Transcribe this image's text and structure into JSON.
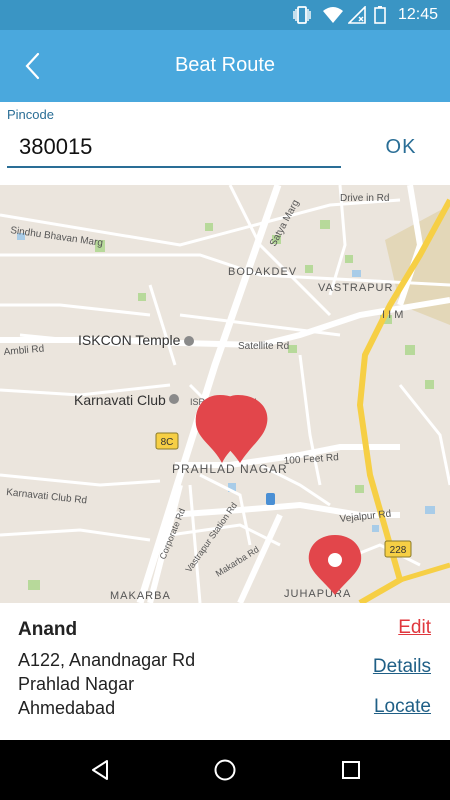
{
  "status_bar": {
    "time": "12:45",
    "icons": [
      "vibrate-icon",
      "wifi-icon",
      "no-signal-icon",
      "battery-icon"
    ]
  },
  "app_bar": {
    "title": "Beat Route",
    "back_icon": "chevron-left-icon"
  },
  "search": {
    "label": "Pincode",
    "value": "380015",
    "ok_label": "OK"
  },
  "map": {
    "labels": {
      "drive_in_rd": "Drive in Rd",
      "sindhu_bhavan_marg": "Sindhu Bhavan Marg",
      "satya_marg": "Satya Marg",
      "bodakdev": "BODAKDEV",
      "vastrapur": "VASTRAPUR",
      "iim": "I I M",
      "iskcon_temple": "ISKCON Temple",
      "ambli_rd": "Ambli Rd",
      "satellite_rd": "Satellite Rd",
      "karnavati_club": "Karnavati Club",
      "isro_colony": "ISRO Colony Rd",
      "route_8c": "8C",
      "prahlad_nagar": "PRAHLAD NAGAR",
      "feet_100_rd": "100 Feet Rd",
      "karnavati_club_rd": "Karnavati Club Rd",
      "corporate_rd": "Corporate Rd",
      "vastrapur_station_rd": "Vastrapur Station Rd",
      "vejalpur_rd": "Vejalpur Rd",
      "route_228": "228",
      "makarba_rd": "Makarba Rd",
      "makarba": "MAKARBA",
      "juhapura": "JUHAPURA"
    },
    "colors": {
      "land": "#ebe5dd",
      "road": "#ffffff",
      "highway": "#f6cf45",
      "park": "#b7d99a",
      "water": "#a8cce8",
      "marker": "#e2464b"
    }
  },
  "details": {
    "name": "Anand",
    "address_line1": "A122, Anandnagar Rd",
    "address_line2": "Prahlad Nagar",
    "address_line3": "Ahmedabad",
    "edit_label": "Edit",
    "details_label": "Details",
    "locate_label": "Locate"
  },
  "nav_bar": {
    "icons": [
      "back-triangle-icon",
      "home-circle-icon",
      "recents-square-icon"
    ]
  }
}
